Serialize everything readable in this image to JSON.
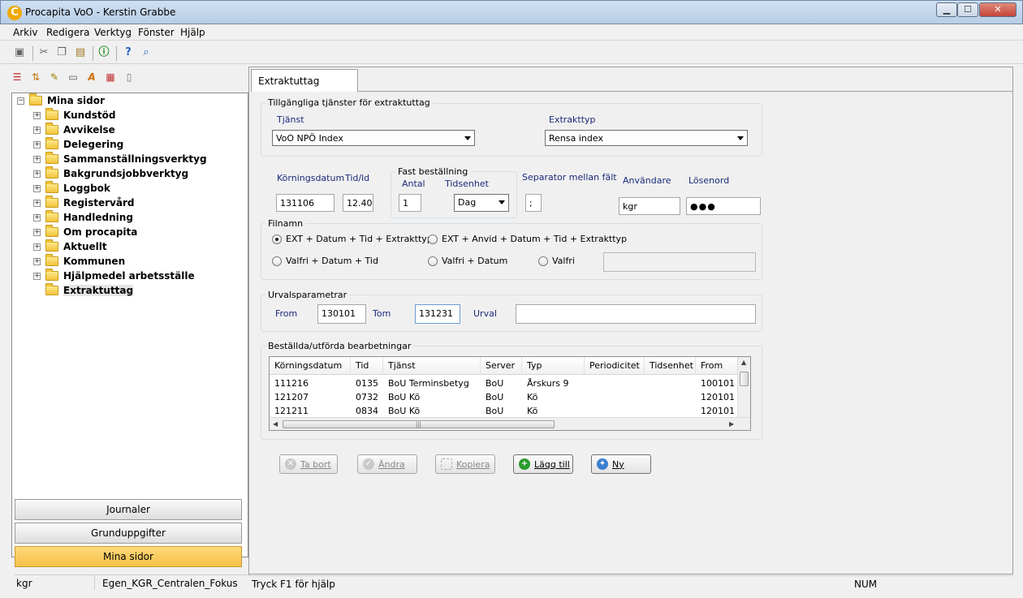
{
  "window": {
    "title": "Procapita VoO - Kerstin Grabbe",
    "app_icon_letter": "C"
  },
  "menu": [
    "Arkiv",
    "Redigera",
    "Verktyg",
    "Fönster",
    "Hjälp"
  ],
  "tree": {
    "root": "Mina sidor",
    "items": [
      "Kundstöd",
      "Avvikelse",
      "Delegering",
      "Sammanställningsverktyg",
      "Bakgrundsjobbverktyg",
      "Loggbok",
      "Registervård",
      "Handledning",
      "Om procapita",
      "Aktuellt",
      "Kommunen",
      "Hjälpmedel arbetsställe"
    ],
    "leaf": "Extraktuttag"
  },
  "nav": {
    "journaler": "Journaler",
    "grunduppgifter": "Grunduppgifter",
    "mina_sidor": "Mina sidor"
  },
  "status": {
    "user": "kgr",
    "profile": "Egen_KGR_Centralen_Fokus",
    "help": "Tryck F1 för hjälp",
    "num": "NUM"
  },
  "tab": {
    "label": "Extraktuttag"
  },
  "services": {
    "title": "Tillgängliga tjänster för extraktuttag",
    "tjanst_label": "Tjänst",
    "tjanst_value": "VoO NPÖ Index",
    "typ_label": "Extrakttyp",
    "typ_value": "Rensa index"
  },
  "params": {
    "korningsdatum_label": "Körningsdatum",
    "korningsdatum_value": "131106",
    "tid_label": "Tid/ld",
    "tid_value": "12.40",
    "fast_title": "Fast beställning",
    "antal_label": "Antal",
    "antal_value": "1",
    "tidsenhet_label": "Tidsenhet",
    "tidsenhet_value": "Dag",
    "separator_label": "Separator mellan fält",
    "separator_value": ";",
    "anvandare_label": "Användare",
    "anvandare_value": "kgr",
    "losenord_label": "Lösenord",
    "losenord_value": "●●●"
  },
  "filnamn": {
    "title": "Filnamn",
    "options": [
      "EXT + Datum + Tid + Extrakttyp",
      "EXT + Anvid + Datum + Tid + Extrakttyp",
      "Valfri + Datum + Tid",
      "Valfri + Datum",
      "Valfri"
    ],
    "selected_index": 0
  },
  "urval": {
    "title": "Urvalsparametrar",
    "from_label": "From",
    "from_value": "130101",
    "tom_label": "Tom",
    "tom_value": "131231",
    "urval_label": "Urval"
  },
  "orders": {
    "title": "Beställda/utförda bearbetningar",
    "columns": [
      "Körningsdatum",
      "Tid",
      "Tjänst",
      "Server",
      "Typ",
      "Periodicitet",
      "Tidsenhet",
      "From"
    ],
    "rows": [
      [
        "111216",
        "0135",
        "BoU Terminsbetyg",
        "BoU",
        "Årskurs 9",
        "",
        "",
        "100101"
      ],
      [
        "121207",
        "0732",
        "BoU Kö",
        "BoU",
        "Kö",
        "",
        "",
        "120101"
      ],
      [
        "121211",
        "0834",
        "BoU Kö",
        "BoU",
        "Kö",
        "",
        "",
        "120101"
      ]
    ]
  },
  "buttons": {
    "ta_bort": "Ta bort",
    "andra": "Ändra",
    "kopiera": "Kopiera",
    "lagg_till": "Lägg till",
    "ny": "Ny"
  }
}
